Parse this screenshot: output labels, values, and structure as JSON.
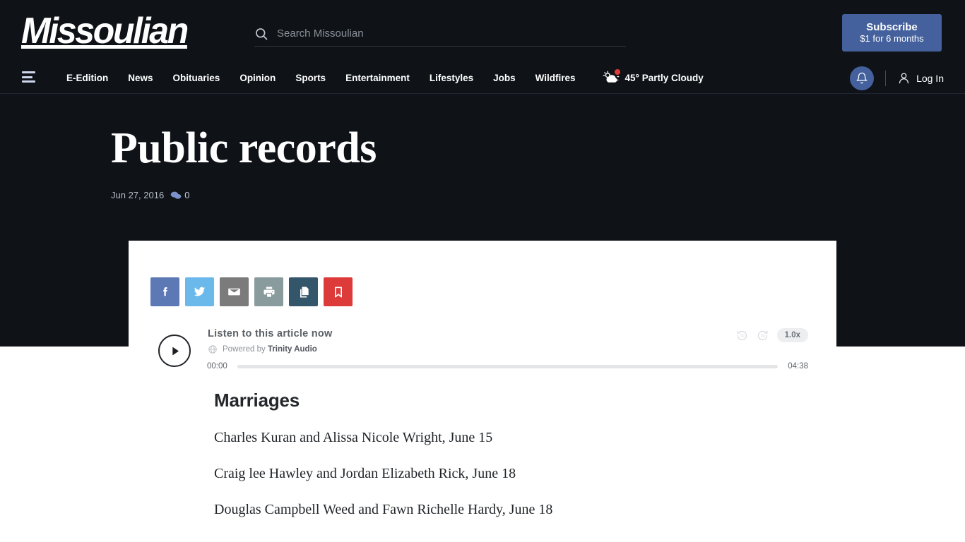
{
  "site": {
    "logo_text": "Missoulian",
    "background_color": "#0f1318",
    "accent_color": "#44619d"
  },
  "search": {
    "placeholder": "Search Missoulian",
    "value": "",
    "icon": "search-icon"
  },
  "subscribe": {
    "main_label": "Subscribe",
    "sub_label": "$1 for 6 months",
    "color": "#44619d"
  },
  "nav": {
    "menu_icon": "hamburger-icon",
    "items": [
      {
        "label": "E-Edition"
      },
      {
        "label": "News"
      },
      {
        "label": "Obituaries"
      },
      {
        "label": "Opinion"
      },
      {
        "label": "Sports"
      },
      {
        "label": "Entertainment"
      },
      {
        "label": "Lifestyles"
      },
      {
        "label": "Jobs"
      },
      {
        "label": "Wildfires"
      }
    ],
    "weather": {
      "text": "45° Partly Cloudy",
      "icon": "partly-cloudy-icon",
      "alert_dot_color": "#e23b37"
    },
    "notifications_icon": "bell-icon",
    "account": {
      "icon": "user-icon",
      "label": "Log In"
    }
  },
  "article": {
    "title": "Public records",
    "date": "Jun 27, 2016",
    "comment_count": "0",
    "comment_icon": "comment-bubble-icon"
  },
  "share": {
    "buttons": [
      {
        "name": "facebook",
        "icon": "facebook-icon",
        "color": "#5d79b5"
      },
      {
        "name": "twitter",
        "icon": "twitter-icon",
        "color": "#6bb9ea"
      },
      {
        "name": "email",
        "icon": "envelope-icon",
        "color": "#7b7b7b"
      },
      {
        "name": "print",
        "icon": "printer-icon",
        "color": "#8a9b9d"
      },
      {
        "name": "copy-link",
        "icon": "copy-icon",
        "color": "#34566b"
      },
      {
        "name": "save",
        "icon": "bookmark-icon",
        "color": "#dd3a3a"
      }
    ]
  },
  "audio": {
    "play_icon": "play-icon",
    "title": "Listen to this article now",
    "powered_prefix": "Powered by",
    "powered_brand": "Trinity Audio",
    "globe_icon": "globe-icon",
    "rewind_icon": "rewind-10-icon",
    "forward_icon": "forward-10-icon",
    "speed": "1.0x",
    "current_time": "00:00",
    "duration": "04:38",
    "progress_percent": 0
  },
  "body": {
    "section_heading": "Marriages",
    "paragraphs": [
      "Charles Kuran and Alissa Nicole Wright, June 15",
      "Craig lee Hawley and Jordan Elizabeth Rick, June 18",
      "Douglas Campbell Weed and Fawn Richelle Hardy, June 18"
    ]
  }
}
